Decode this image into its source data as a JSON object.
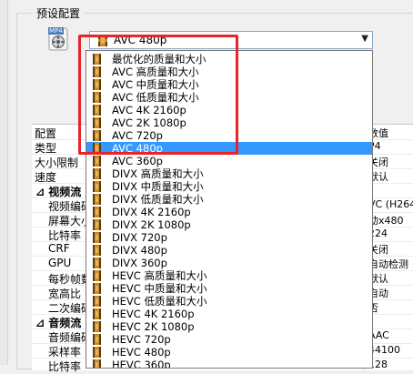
{
  "group": {
    "title": "预设配置"
  },
  "icon": {
    "badge_text": "MP4"
  },
  "combo": {
    "selected": "AVC 480p"
  },
  "dropdown": {
    "items": [
      "最优化的质量和大小",
      "AVC 高质量和大小",
      "AVC 中质量和大小",
      "AVC 低质量和大小",
      "AVC 4K 2160p",
      "AVC 2K 1080p",
      "AVC 720p",
      "AVC 480p",
      "AVC 360p",
      "DIVX 高质量和大小",
      "DIVX 中质量和大小",
      "DIVX 低质量和大小",
      "DIVX 4K 2160p",
      "DIVX 2K 1080p",
      "DIVX 720p",
      "DIVX 480p",
      "DIVX 360p",
      "HEVC 高质量和大小",
      "HEVC 中质量和大小",
      "HEVC 低质量和大小",
      "HEVC 4K 2160p",
      "HEVC 2K 1080p",
      "HEVC 720p",
      "HEVC 480p",
      "HEVC 360p"
    ],
    "selected_index": 7
  },
  "properties": {
    "rows": [
      {
        "key": "配置",
        "value": "数值",
        "kind": "top"
      },
      {
        "key": "类型",
        "value": "P4",
        "kind": "top"
      },
      {
        "key": "大小限制（",
        "value": "关闭",
        "kind": "top"
      },
      {
        "key": "速度",
        "value": "默认",
        "kind": "top"
      },
      {
        "key": "视频流",
        "value": "",
        "kind": "section"
      },
      {
        "key": "视频编码",
        "value": "VC (H264)",
        "kind": "item"
      },
      {
        "key": "屏幕大小",
        "value": "动x480",
        "kind": "item"
      },
      {
        "key": "比特率",
        "value": "224",
        "kind": "item"
      },
      {
        "key": "CRF",
        "value": "关闭",
        "kind": "item"
      },
      {
        "key": "GPU",
        "value": "自动检测",
        "kind": "item"
      },
      {
        "key": "每秒帧数",
        "value": "默认",
        "kind": "item"
      },
      {
        "key": "宽高比",
        "value": "自动",
        "kind": "item"
      },
      {
        "key": "二次编码",
        "value": "否",
        "kind": "item"
      },
      {
        "key": "音频流",
        "value": "",
        "kind": "section"
      },
      {
        "key": "音频编码",
        "value": "AAC",
        "kind": "item"
      },
      {
        "key": "采样率",
        "value": "44100",
        "kind": "item"
      },
      {
        "key": "比特率",
        "value": "128",
        "kind": "item"
      }
    ]
  }
}
